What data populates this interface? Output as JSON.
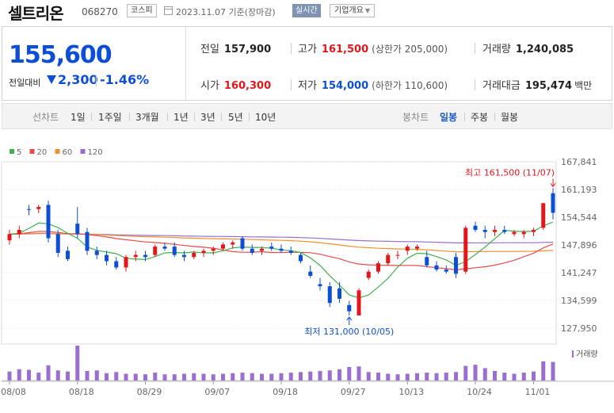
{
  "header": {
    "name": "셀트리온",
    "code": "068270",
    "market": "코스피",
    "date_text": "2023.11.07  기준(장마감)",
    "live_label": "실시간",
    "overview_label": "기업개요"
  },
  "quote": {
    "price": "155,600",
    "change_label": "전일대비",
    "change": "2,300",
    "change_pct": "-1.46%",
    "prev_close_label": "전일",
    "prev_close": "157,900",
    "high_label": "고가",
    "high": "161,500",
    "upper_limit": "(상한가 205,000)",
    "volume_label": "거래량",
    "volume": "1,240,085",
    "open_label": "시가",
    "open": "160,300",
    "low_label": "저가",
    "low": "154,000",
    "lower_limit": "(하한가 110,600)",
    "amount_label": "거래대금",
    "amount": "195,474",
    "amount_unit": "백만"
  },
  "toolbar": {
    "line_label": "선차트",
    "line_periods": [
      "1일",
      "1주일",
      "3개월",
      "1년",
      "3년",
      "5년",
      "10년"
    ],
    "candle_label": "봉차트",
    "candle_periods": [
      "일봉",
      "주봉",
      "월봉"
    ],
    "active": "일봉"
  },
  "colors": {
    "up": "#e3161c",
    "down": "#0c4fd4",
    "ma5": "#3fb24c",
    "ma20": "#e84a4a",
    "ma60": "#f0912f",
    "ma120": "#9b6fcf"
  },
  "chart_data": {
    "type": "candlestick",
    "legend": [
      {
        "name": "5",
        "color": "#3fb24c"
      },
      {
        "name": "20",
        "color": "#e84a4a"
      },
      {
        "name": "60",
        "color": "#f0912f"
      },
      {
        "name": "120",
        "color": "#9b6fcf"
      }
    ],
    "y_ticks": [
      167841,
      161193,
      154544,
      147896,
      141247,
      134599,
      127950
    ],
    "ylim": [
      127950,
      167841
    ],
    "x_ticks": [
      "08/08",
      "08/18",
      "08/29",
      "09/07",
      "09/18",
      "09/27",
      "10/13",
      "10/24",
      "11/01"
    ],
    "x_tick_index": [
      0,
      7,
      14,
      21,
      28,
      35,
      41,
      48,
      54
    ],
    "max_annotation": "최고 161,500 (11/07)",
    "min_annotation": "최저 131,000 (10/05)",
    "volume_label": "거래량",
    "candles": [
      {
        "o": 149000,
        "h": 151500,
        "l": 148000,
        "c": 150500
      },
      {
        "o": 150500,
        "h": 152500,
        "l": 149500,
        "c": 151500
      },
      {
        "o": 156500,
        "h": 157500,
        "l": 155000,
        "c": 156300
      },
      {
        "o": 156500,
        "h": 157500,
        "l": 155500,
        "c": 157000
      },
      {
        "o": 157500,
        "h": 158500,
        "l": 148500,
        "c": 149500
      },
      {
        "o": 150500,
        "h": 151500,
        "l": 145000,
        "c": 146000
      },
      {
        "o": 146500,
        "h": 147500,
        "l": 144000,
        "c": 144500
      },
      {
        "o": 153000,
        "h": 157000,
        "l": 149500,
        "c": 150500
      },
      {
        "o": 151000,
        "h": 152000,
        "l": 145500,
        "c": 146500
      },
      {
        "o": 146500,
        "h": 147500,
        "l": 144500,
        "c": 145500
      },
      {
        "o": 145500,
        "h": 146500,
        "l": 143000,
        "c": 144000
      },
      {
        "o": 144000,
        "h": 145000,
        "l": 142000,
        "c": 142500
      },
      {
        "o": 142500,
        "h": 145500,
        "l": 141500,
        "c": 145000
      },
      {
        "o": 145000,
        "h": 146500,
        "l": 144000,
        "c": 145500
      },
      {
        "o": 145500,
        "h": 146500,
        "l": 144000,
        "c": 145000
      },
      {
        "o": 145500,
        "h": 148000,
        "l": 145000,
        "c": 147500
      },
      {
        "o": 147500,
        "h": 148500,
        "l": 146500,
        "c": 147000
      },
      {
        "o": 147500,
        "h": 148500,
        "l": 145000,
        "c": 145500
      },
      {
        "o": 145500,
        "h": 146500,
        "l": 144000,
        "c": 145000
      },
      {
        "o": 145000,
        "h": 146500,
        "l": 144500,
        "c": 146000
      },
      {
        "o": 146000,
        "h": 147000,
        "l": 145000,
        "c": 146500
      },
      {
        "o": 146500,
        "h": 147500,
        "l": 145500,
        "c": 147000
      },
      {
        "o": 147000,
        "h": 148500,
        "l": 146500,
        "c": 148000
      },
      {
        "o": 148000,
        "h": 149000,
        "l": 147000,
        "c": 148500
      },
      {
        "o": 149500,
        "h": 150000,
        "l": 146500,
        "c": 147000
      },
      {
        "o": 147000,
        "h": 148000,
        "l": 145500,
        "c": 146000
      },
      {
        "o": 146500,
        "h": 147500,
        "l": 145500,
        "c": 147000
      },
      {
        "o": 147500,
        "h": 148500,
        "l": 146500,
        "c": 147000
      },
      {
        "o": 147000,
        "h": 148000,
        "l": 146000,
        "c": 146500
      },
      {
        "o": 146500,
        "h": 147500,
        "l": 145500,
        "c": 146000
      },
      {
        "o": 145500,
        "h": 146000,
        "l": 143500,
        "c": 144000
      },
      {
        "o": 141500,
        "h": 143000,
        "l": 140000,
        "c": 140500
      },
      {
        "o": 138500,
        "h": 140000,
        "l": 137000,
        "c": 138000
      },
      {
        "o": 138000,
        "h": 139000,
        "l": 133000,
        "c": 134000
      },
      {
        "o": 137500,
        "h": 139000,
        "l": 134000,
        "c": 135000
      },
      {
        "o": 133500,
        "h": 134500,
        "l": 131000,
        "c": 132000
      },
      {
        "o": 131000,
        "h": 137500,
        "l": 131000,
        "c": 137000
      },
      {
        "o": 140000,
        "h": 142000,
        "l": 139500,
        "c": 141500
      },
      {
        "o": 141500,
        "h": 144000,
        "l": 141000,
        "c": 143500
      },
      {
        "o": 143500,
        "h": 146000,
        "l": 143000,
        "c": 145500
      },
      {
        "o": 145500,
        "h": 146500,
        "l": 144500,
        "c": 145500
      },
      {
        "o": 146500,
        "h": 148000,
        "l": 145500,
        "c": 147500
      },
      {
        "o": 147000,
        "h": 148000,
        "l": 146500,
        "c": 147500
      },
      {
        "o": 145000,
        "h": 146500,
        "l": 142500,
        "c": 143000
      },
      {
        "o": 143000,
        "h": 144000,
        "l": 141500,
        "c": 142000
      },
      {
        "o": 142000,
        "h": 143000,
        "l": 141000,
        "c": 141500
      },
      {
        "o": 145000,
        "h": 146000,
        "l": 140000,
        "c": 141000
      },
      {
        "o": 141500,
        "h": 152500,
        "l": 141000,
        "c": 152000
      },
      {
        "o": 152500,
        "h": 153500,
        "l": 151000,
        "c": 151500
      },
      {
        "o": 151500,
        "h": 152500,
        "l": 149500,
        "c": 151000
      },
      {
        "o": 151000,
        "h": 152500,
        "l": 150000,
        "c": 151500
      },
      {
        "o": 151500,
        "h": 152500,
        "l": 150500,
        "c": 151000
      },
      {
        "o": 150500,
        "h": 151500,
        "l": 150000,
        "c": 151000
      },
      {
        "o": 150500,
        "h": 151500,
        "l": 149500,
        "c": 151000
      },
      {
        "o": 151000,
        "h": 152000,
        "l": 150000,
        "c": 151500
      },
      {
        "o": 152000,
        "h": 158000,
        "l": 151500,
        "c": 157900
      },
      {
        "o": 160300,
        "h": 161500,
        "l": 154000,
        "c": 155600
      }
    ],
    "volume": [
      16,
      20,
      19,
      14,
      27,
      18,
      16,
      62,
      17,
      18,
      13,
      15,
      12,
      12,
      11,
      14,
      11,
      11,
      12,
      13,
      12,
      11,
      12,
      13,
      14,
      13,
      12,
      12,
      13,
      14,
      15,
      16,
      17,
      18,
      20,
      24,
      25,
      15,
      14,
      12,
      11,
      12,
      13,
      14,
      13,
      14,
      15,
      26,
      28,
      22,
      17,
      14,
      12,
      14,
      16,
      34,
      33
    ]
  }
}
